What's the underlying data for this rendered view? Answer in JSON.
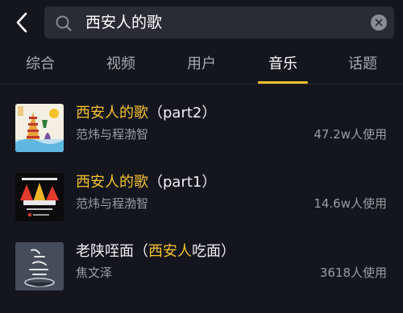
{
  "search": {
    "query": "西安人的歌"
  },
  "tabs": [
    {
      "label": "综合"
    },
    {
      "label": "视频"
    },
    {
      "label": "用户"
    },
    {
      "label": "音乐",
      "active": true
    },
    {
      "label": "话题"
    }
  ],
  "colors": {
    "background": "#15161d",
    "accent": "#f5c12c",
    "search_bg": "#2a2b33",
    "muted_text": "#9c9da4"
  },
  "songs": [
    {
      "title_highlight": "西安人的歌",
      "title_rest": "（part2）",
      "artist": "范炜与程渤智",
      "usage": "47.2w人使用"
    },
    {
      "title_highlight": "西安人的歌",
      "title_rest": "（part1）",
      "artist": "范炜与程渤智",
      "usage": "14.6w人使用"
    },
    {
      "title_prefix": "老陕咥面（",
      "title_highlight": "西安人",
      "title_rest": "吃面）",
      "artist": "焦文泽",
      "usage": "3618人使用"
    }
  ],
  "icons": {
    "back": "chevron-left-icon",
    "search": "search-icon",
    "clear": "close-icon"
  }
}
